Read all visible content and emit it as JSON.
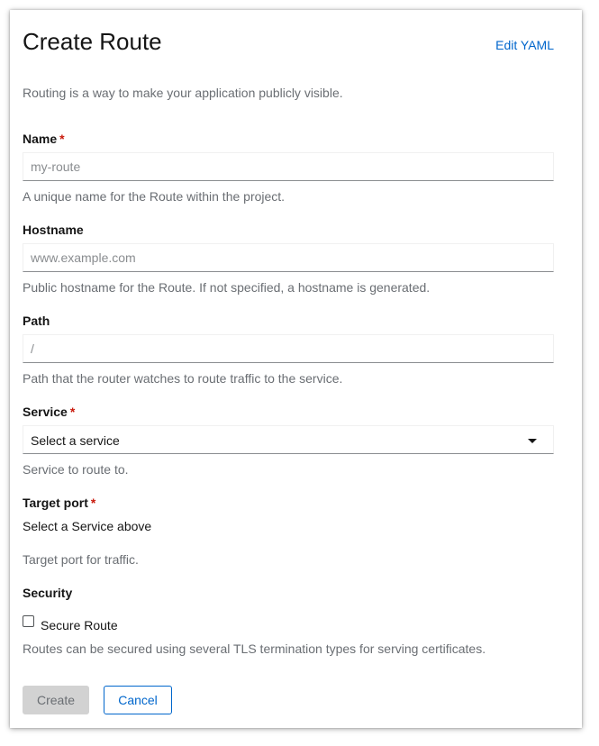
{
  "header": {
    "title": "Create Route",
    "edit_yaml": "Edit YAML",
    "intro": "Routing is a way to make your application publicly visible."
  },
  "form": {
    "name": {
      "label": "Name",
      "required_mark": "*",
      "placeholder": "my-route",
      "value": "",
      "help": "A unique name for the Route within the project."
    },
    "hostname": {
      "label": "Hostname",
      "placeholder": "www.example.com",
      "value": "",
      "help": "Public hostname for the Route. If not specified, a hostname is generated."
    },
    "path": {
      "label": "Path",
      "placeholder": "/",
      "value": "",
      "help": "Path that the router watches to route traffic to the service."
    },
    "service": {
      "label": "Service",
      "required_mark": "*",
      "selected": "Select a service",
      "help": "Service to route to."
    },
    "target_port": {
      "label": "Target port",
      "required_mark": "*",
      "value": "Select a Service above",
      "help": "Target port for traffic."
    },
    "security": {
      "label": "Security",
      "checkbox_label": "Secure Route",
      "checked": false,
      "help": "Routes can be secured using several TLS termination types for serving certificates."
    }
  },
  "actions": {
    "create_label": "Create",
    "cancel_label": "Cancel"
  },
  "colors": {
    "link": "#0066cc",
    "required": "#c9190b",
    "help_text": "#6a6e73",
    "disabled_button": "#d2d2d2"
  }
}
